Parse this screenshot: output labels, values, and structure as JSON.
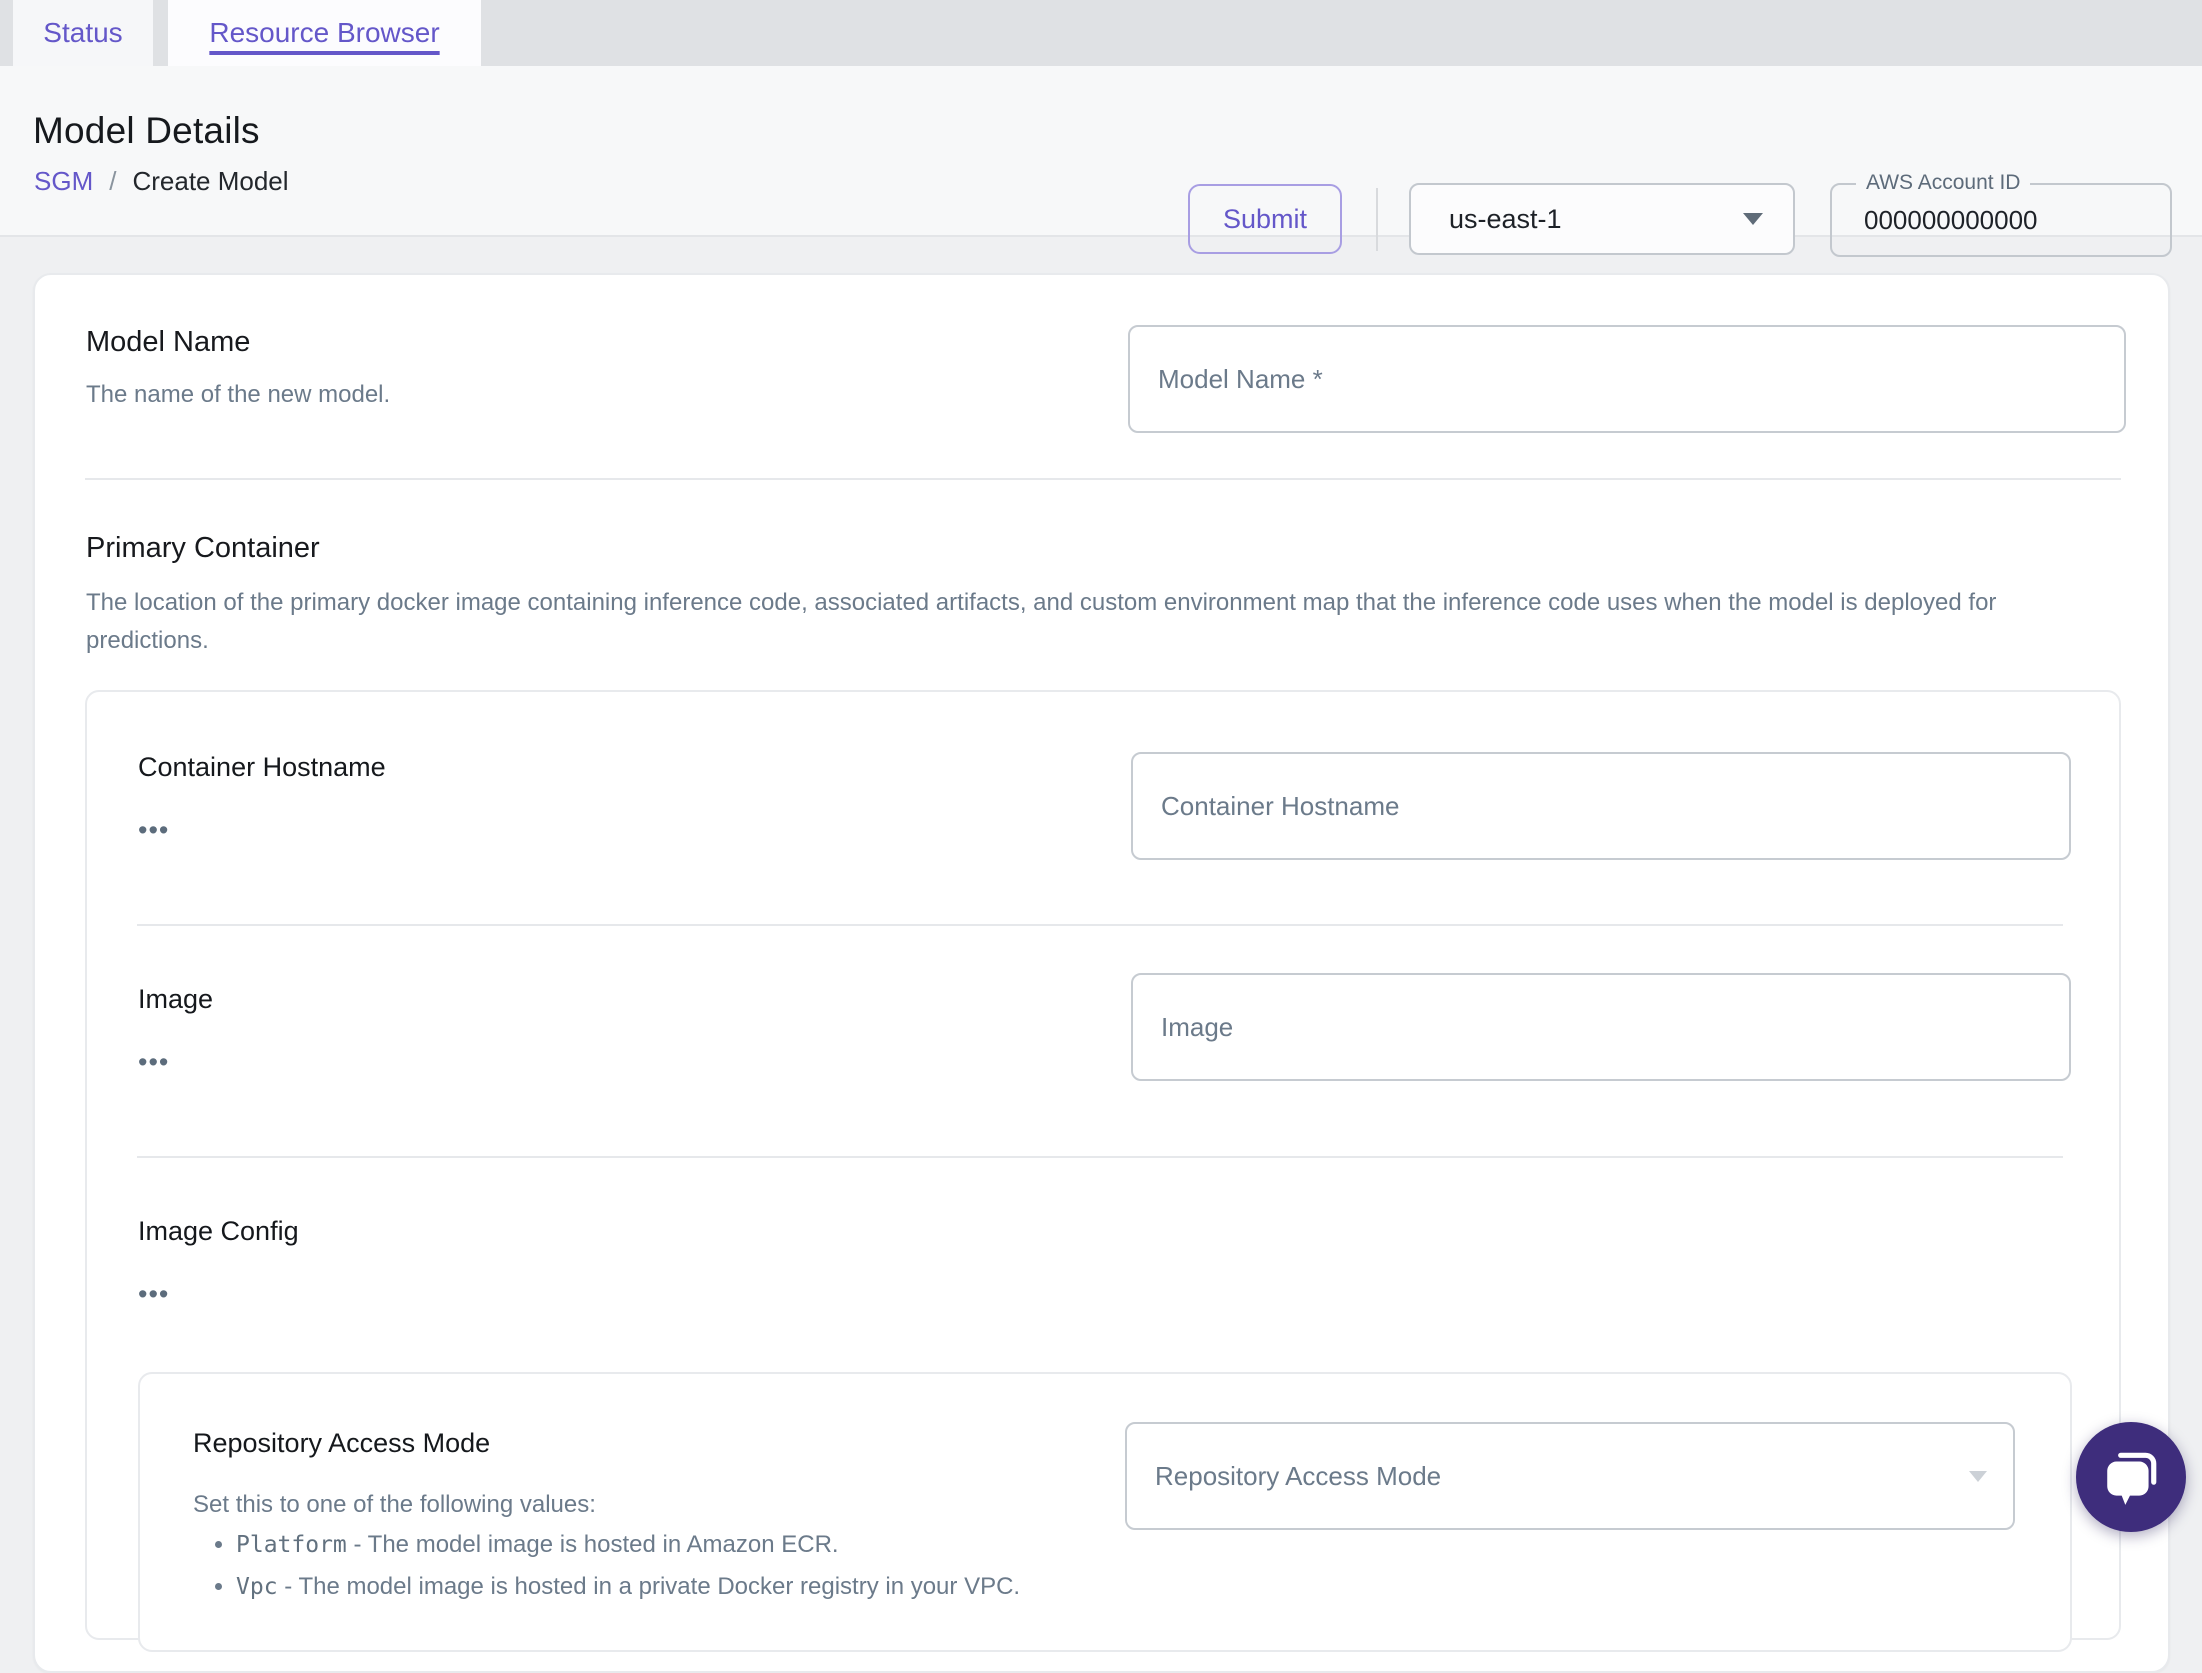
{
  "tabs": {
    "status": "Status",
    "resource_browser": "Resource Browser"
  },
  "header": {
    "title": "Model Details",
    "breadcrumb": {
      "root": "SGM",
      "separator": "/",
      "current": "Create Model"
    },
    "submit_label": "Submit",
    "region_select": {
      "value": "us-east-1"
    },
    "account_field": {
      "label": "AWS Account ID",
      "value": "000000000000"
    }
  },
  "ui": {
    "more_label": "•••"
  },
  "form": {
    "model_name": {
      "label": "Model Name",
      "description": "The name of the new model.",
      "placeholder": "Model Name *"
    },
    "primary_container": {
      "label": "Primary Container",
      "description": "The location of the primary docker image containing inference code, associated artifacts, and custom environment map that the inference code uses when the model is deployed for predictions.",
      "container_hostname": {
        "label": "Container Hostname",
        "placeholder": "Container Hostname"
      },
      "image": {
        "label": "Image",
        "placeholder": "Image"
      },
      "image_config": {
        "label": "Image Config",
        "repository_access_mode": {
          "label": "Repository Access Mode",
          "description": "Set this to one of the following values:",
          "options_help": [
            {
              "code": "Platform",
              "text": " - The model image is hosted in Amazon ECR."
            },
            {
              "code": "Vpc",
              "text": " - The model image is hosted in a private Docker registry in your VPC."
            }
          ],
          "placeholder": "Repository Access Mode"
        }
      }
    }
  },
  "colors": {
    "accent": "#6457c9",
    "chat_launcher": "#3e2d7c"
  }
}
